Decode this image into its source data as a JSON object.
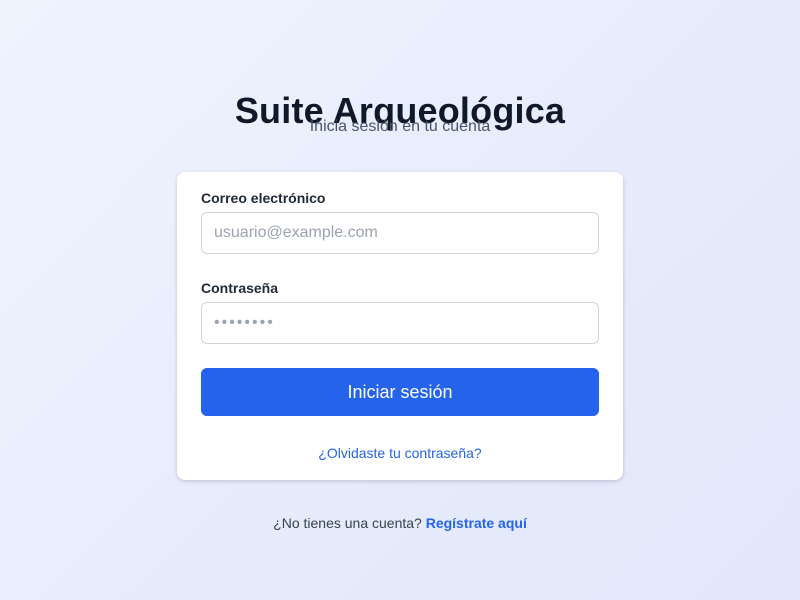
{
  "header": {
    "title": "Suite Arqueológica",
    "subtitle": "Inicia sesión en tu cuenta"
  },
  "login_form": {
    "email_label": "Correo electrónico",
    "email_placeholder": "usuario@example.com",
    "password_label": "Contraseña",
    "password_placeholder": "••••••••",
    "submit_label": "Iniciar sesión",
    "forgot_password_label": "¿Olvidaste tu contraseña?"
  },
  "footer": {
    "no_account_text": "¿No tienes una cuenta?",
    "signup_label": "Regístrate aquí"
  },
  "colors": {
    "accent": "#2563eb",
    "background_start": "#eef4fe",
    "background_end": "#e2e7fa",
    "card": "#ffffff"
  }
}
